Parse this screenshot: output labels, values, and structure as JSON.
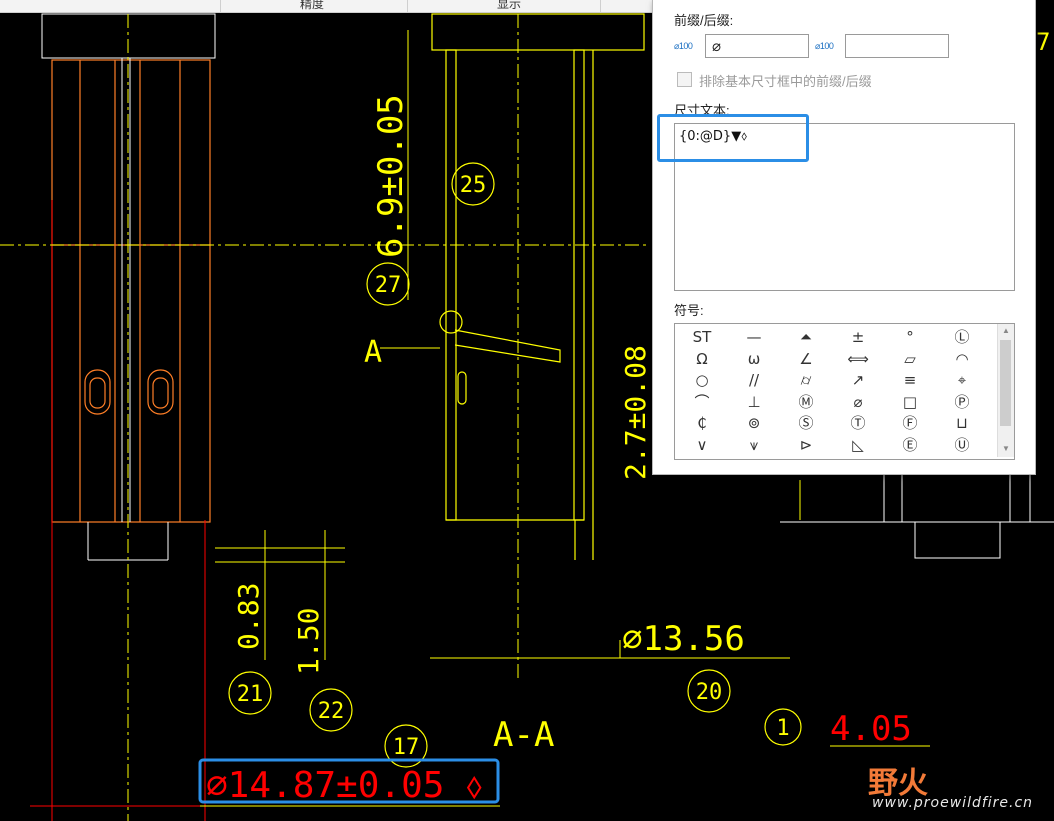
{
  "header": {
    "col1": "精度",
    "col2": "显示"
  },
  "panel": {
    "prefix_suffix_label": "前缀/后缀:",
    "prefix_icon": "⌀100",
    "prefix_value": "⌀",
    "suffix_icon": "⌀100",
    "suffix_value": "",
    "exclude_label": "排除基本尺寸框中的前缀/后缀",
    "dim_text_label": "尺寸文本:",
    "dim_text_value": "{0:@D}▼⬨",
    "symbols_label": "符号:",
    "symbols": [
      [
        "ST",
        "—",
        "⏶",
        "±",
        "°",
        "Ⓛ"
      ],
      [
        "Ω",
        "ω",
        "∠",
        "⟺",
        "▱",
        "◠"
      ],
      [
        "○",
        "//",
        "⌭",
        "↗",
        "≡",
        "⌖"
      ],
      [
        "⌒",
        "⊥",
        "Ⓜ",
        "⌀",
        "□",
        "Ⓟ"
      ],
      [
        "₵",
        "⊚",
        "Ⓢ",
        "Ⓣ",
        "Ⓕ",
        "⊔"
      ],
      [
        "∨",
        "⩛",
        "⊳",
        "◺",
        "Ⓔ",
        "Ⓤ"
      ]
    ]
  },
  "drawing": {
    "dim_tol_1": "6.9±0.05",
    "dim_tol_2": "2.7±0.08",
    "dim_0_83": "0.83",
    "dim_1_50": "1.50",
    "dim_diam_13_56": "⌀13.56",
    "dim_4_05": "4.05",
    "dim_selected": "⌀14.87±0.05 ⬨",
    "section_label": "A-A",
    "leader_label": "A",
    "balloon_25": "25",
    "balloon_27": "27",
    "balloon_21": "21",
    "balloon_22": "22",
    "balloon_20": "20",
    "balloon_17": "17",
    "balloon_1": "1",
    "partial_digit": "7"
  },
  "watermark": {
    "brand": "野火",
    "url": "www.proewildfire.cn"
  },
  "colors": {
    "cad_background": "#000000",
    "cad_yellow": "#ffff00",
    "cad_orange": "#ff7f27",
    "cad_red": "#ff0000",
    "highlight_blue": "#2b8ee6"
  }
}
